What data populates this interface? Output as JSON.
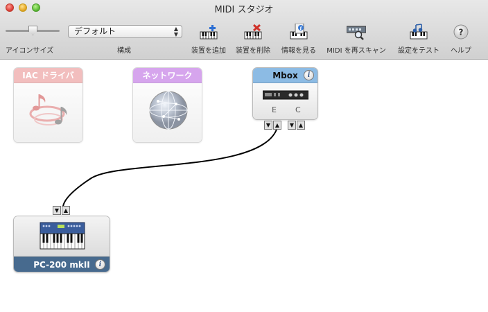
{
  "window": {
    "title": "MIDI スタジオ"
  },
  "toolbar": {
    "icon_size_label": "アイコンサイズ",
    "configuration": {
      "selected": "デフォルト",
      "label": "構成"
    },
    "buttons": [
      {
        "label": "装置を追加",
        "icon": "add-device-icon"
      },
      {
        "label": "装置を削除",
        "icon": "remove-device-icon"
      },
      {
        "label": "情報を見る",
        "icon": "show-info-icon"
      },
      {
        "label": "MIDI を再スキャン",
        "icon": "rescan-midi-icon"
      },
      {
        "label": "設定をテスト",
        "icon": "test-setup-icon"
      },
      {
        "label": "ヘルプ",
        "icon": "help-icon"
      }
    ]
  },
  "devices": {
    "iac": {
      "name": "IAC ドライバ",
      "color": "#e98989"
    },
    "network": {
      "name": "ネットワーク",
      "color": "#b55de0"
    },
    "mbox": {
      "name": "Mbox",
      "port_e": "E",
      "port_c": "C",
      "color": "#8cbbe4"
    },
    "pc200": {
      "name": "PC-200 mkII",
      "color": "#476a8e"
    }
  },
  "colors": {
    "connection": "#000000",
    "titlebar": "#d6d6d6"
  }
}
